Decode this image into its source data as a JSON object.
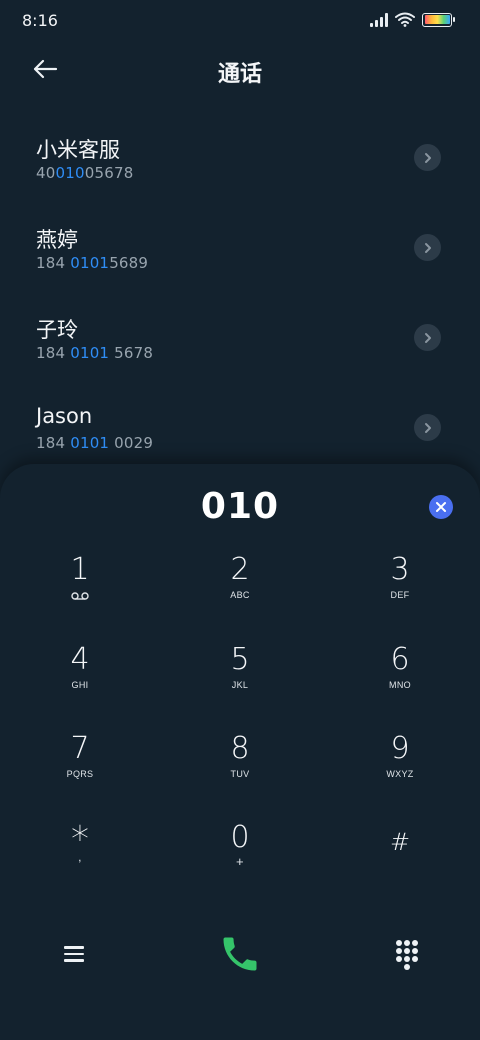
{
  "status_bar": {
    "time": "8:16"
  },
  "header": {
    "title": "通话",
    "back_icon": "arrow-left-icon"
  },
  "contacts": [
    {
      "name": "小米客服",
      "number_parts": [
        "40",
        "010",
        "05678"
      ]
    },
    {
      "name": "燕婷",
      "number_parts": [
        "184 ",
        "0101",
        "5689"
      ]
    },
    {
      "name": "子玲",
      "number_parts": [
        "184 ",
        "0101",
        " 5678"
      ]
    },
    {
      "name": "Jason",
      "number_parts": [
        "184 ",
        "0101",
        " 0029"
      ]
    }
  ],
  "dialer": {
    "input_value": "010",
    "keys": [
      {
        "digit": "1",
        "letters": "",
        "sub_icon": "voicemail-icon"
      },
      {
        "digit": "2",
        "letters": "ABC"
      },
      {
        "digit": "3",
        "letters": "DEF"
      },
      {
        "digit": "4",
        "letters": "GHI"
      },
      {
        "digit": "5",
        "letters": "JKL"
      },
      {
        "digit": "6",
        "letters": "MNO"
      },
      {
        "digit": "7",
        "letters": "PQRS"
      },
      {
        "digit": "8",
        "letters": "TUV"
      },
      {
        "digit": "9",
        "letters": "WXYZ"
      },
      {
        "digit": "*",
        "letters": ","
      },
      {
        "digit": "0",
        "letters": "+"
      },
      {
        "digit": "#",
        "letters": ""
      }
    ]
  },
  "colors": {
    "background": "#13222e",
    "highlight": "#2f8df5",
    "clear_button": "#4a6ff0",
    "call_button": "#35c46a"
  }
}
